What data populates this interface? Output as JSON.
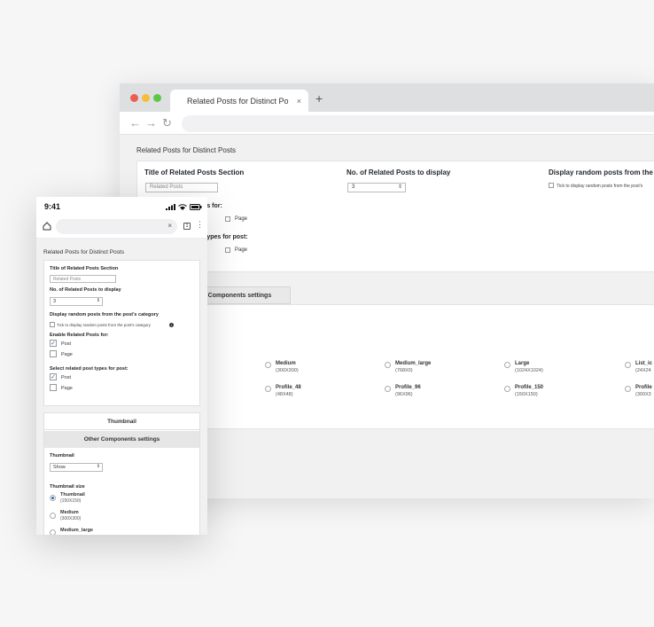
{
  "desktop": {
    "tab_title": "Related Posts for Distinct Po",
    "tab_close": "×",
    "new_tab": "+",
    "nav": {
      "back": "←",
      "forward": "→",
      "reload": "↻"
    },
    "page_title": "Related Posts for Distinct Posts",
    "section_title_label": "Title of Related Posts Section",
    "section_title_value": "Related Posts",
    "num_posts_label": "No. of Related Posts to display",
    "num_posts_value": "3",
    "random_label": "Display random posts from the p",
    "random_tick": "Tick to display random posts from the post's",
    "enable_label_partial": "ts for:",
    "enable_page": "Page",
    "types_label_partial": "types for post:",
    "types_page": "Page",
    "other_tab": "r Components settings",
    "sizes": [
      {
        "name": "Medium",
        "size": "(300X300)"
      },
      {
        "name": "Medium_large",
        "size": "(768X0)"
      },
      {
        "name": "Large",
        "size": "(1024X1024)"
      },
      {
        "name": "List_ic",
        "size": "(24X24"
      },
      {
        "name": "Profile_48",
        "size": "(48X48)"
      },
      {
        "name": "Profile_96",
        "size": "(96X96)"
      },
      {
        "name": "Profile_150",
        "size": "(150X150)"
      },
      {
        "name": "Profile",
        "size": "(300X3"
      }
    ]
  },
  "mobile": {
    "time": "9:41",
    "url_clear": "×",
    "tabs_count": "1",
    "menu": "⋮",
    "page_title": "Related Posts for Distinct Posts",
    "section_title_label": "Title of Related Posts Section",
    "section_title_value": "Related Posts",
    "num_posts_label": "No. of Related Posts to display",
    "num_posts_value": "3",
    "random_label": "Display random posts from the post's category",
    "random_tick": "Tick to display random posts from the post's category",
    "enable_label": "Enable Related Posts for:",
    "enable_post": "Post",
    "enable_page": "Page",
    "types_label": "Select related post types for post:",
    "types_post": "Post",
    "types_page": "Page",
    "tab_thumbnail": "Thumbnail",
    "tab_other": "Other Components settings",
    "thumbnail_label": "Thumbnail",
    "thumbnail_value": "Show",
    "thumbnail_size_label": "Thumbnail size",
    "sizes": [
      {
        "name": "Thumbnail",
        "size": "(150X150)"
      },
      {
        "name": "Medium",
        "size": "(300X300)"
      },
      {
        "name": "Medium_large",
        "size": ""
      }
    ]
  },
  "colors": {
    "accent": "#2271b1",
    "mac_red": "#ee5c54",
    "mac_yellow": "#f6bd3b",
    "mac_green": "#5dc848"
  }
}
